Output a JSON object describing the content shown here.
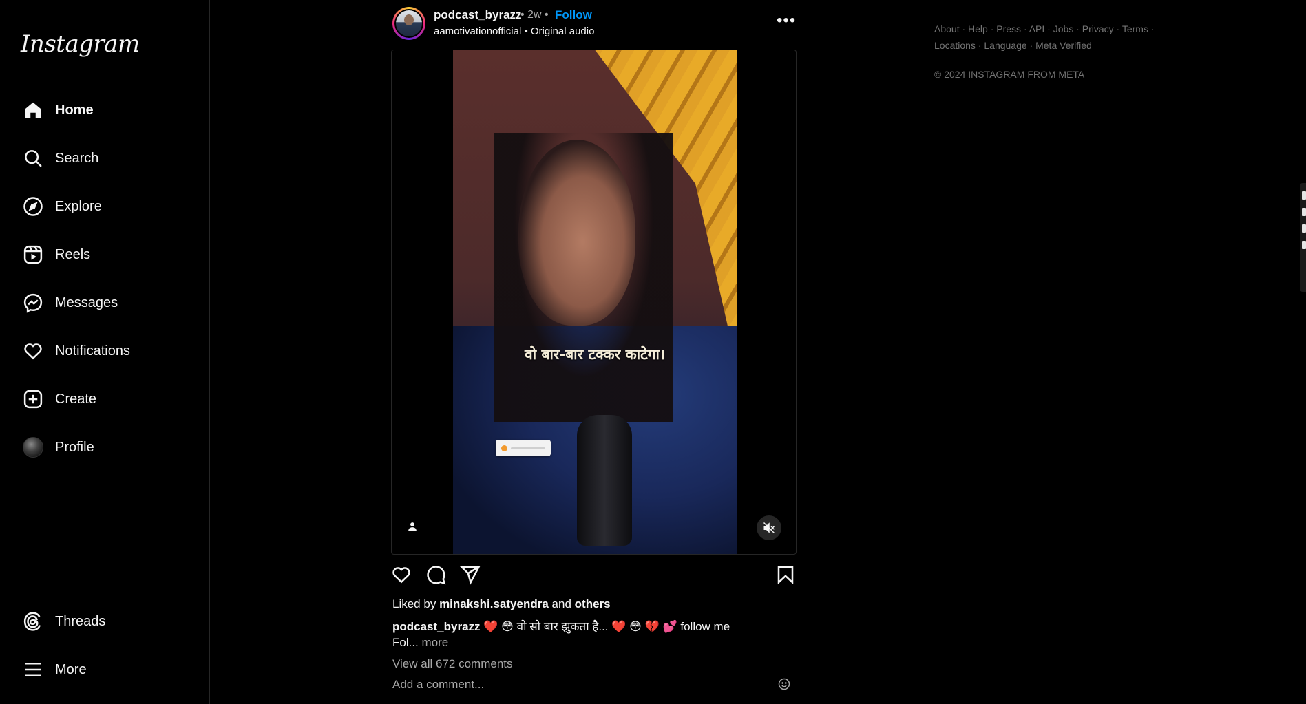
{
  "app": {
    "logo": "Instagram"
  },
  "sidebar": {
    "items": [
      {
        "label": "Home",
        "icon": "home-icon",
        "active": true
      },
      {
        "label": "Search",
        "icon": "search-icon"
      },
      {
        "label": "Explore",
        "icon": "compass-icon"
      },
      {
        "label": "Reels",
        "icon": "reels-icon"
      },
      {
        "label": "Messages",
        "icon": "messenger-icon"
      },
      {
        "label": "Notifications",
        "icon": "heart-icon"
      },
      {
        "label": "Create",
        "icon": "plus-square-icon"
      },
      {
        "label": "Profile",
        "icon": "avatar"
      }
    ],
    "bottom": [
      {
        "label": "Threads",
        "icon": "threads-icon"
      },
      {
        "label": "More",
        "icon": "hamburger-icon"
      }
    ]
  },
  "post": {
    "username": "podcast_byrazz",
    "time": "• 2w •",
    "follow_label": "Follow",
    "audio_account": "aamotivationofficial",
    "audio_label": "• Original audio",
    "more_label": "•••",
    "video_caption": "वो बार-बार टक्कर काटेगा।",
    "liked_prefix": "Liked by",
    "liked_user": "minakshi.satyendra",
    "liked_and": "and",
    "liked_others": "others",
    "caption_user": "podcast_byrazz",
    "caption_text": "❤️ 😳 वो सो बार झुकता है... ❤️ 😳 💔 💕 follow me Fol...",
    "caption_more": "more",
    "view_comments": "View all 672 comments",
    "add_comment_placeholder": "Add a comment..."
  },
  "footer": {
    "links_line1": "About · Help · Press · API · Jobs · Privacy · Terms ·",
    "links_line2": "Locations · Language · Meta Verified",
    "copyright": "© 2024 INSTAGRAM FROM META"
  },
  "colors": {
    "background": "#000000",
    "text": "#f5f5f5",
    "muted": "#a8a8a8",
    "follow_blue": "#0095f6",
    "border": "#262626"
  }
}
